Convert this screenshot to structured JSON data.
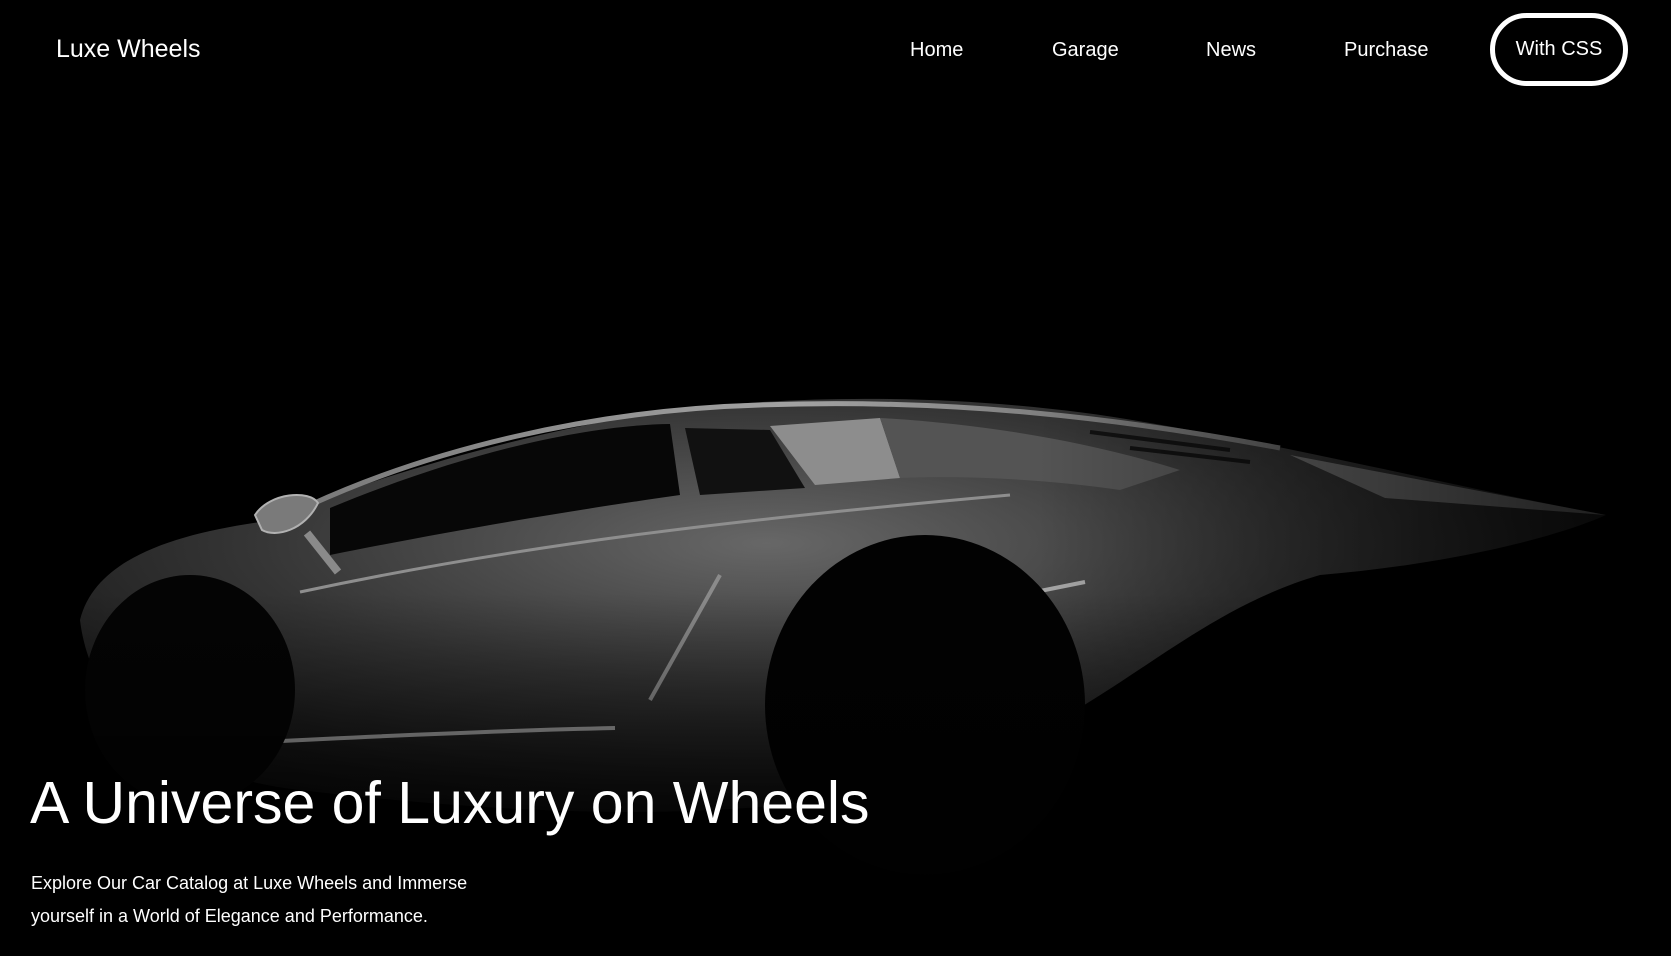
{
  "header": {
    "brand": "Luxe Wheels",
    "nav": {
      "home": "Home",
      "garage": "Garage",
      "news": "News",
      "purchase": "Purchase",
      "cta": "With CSS"
    }
  },
  "hero": {
    "title": "A Universe of Luxury on Wheels",
    "description": "Explore Our Car Catalog at Luxe Wheels and Immerse yourself in a World of Elegance and Performance."
  },
  "colors": {
    "background": "#000000",
    "text": "#ffffff",
    "car_body": "#5e5e5e"
  }
}
